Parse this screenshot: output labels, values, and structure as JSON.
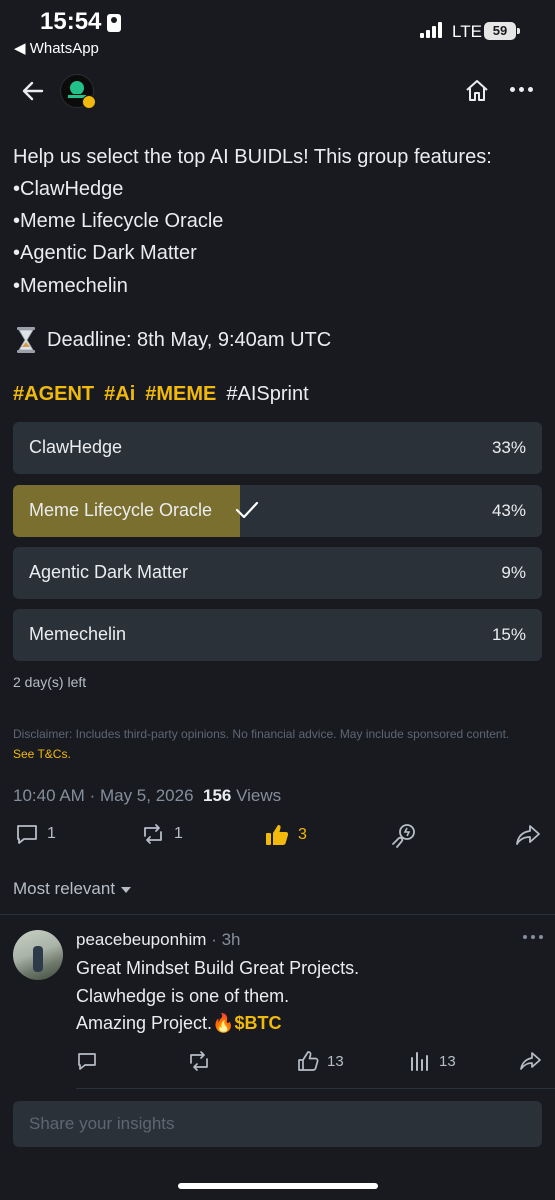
{
  "status_bar": {
    "time": "15:54",
    "back_app": "◀ WhatsApp",
    "network": "LTE",
    "battery": "59"
  },
  "post": {
    "lines": [
      "Help us select the top AI BUIDLs! This group features:",
      "•ClawHedge",
      "•Meme Lifecycle Oracle",
      "•Agentic Dark Matter",
      "•Memechelin"
    ],
    "deadline": "Deadline: 8th May, 9:40am UTC",
    "hashtags": [
      {
        "text": "#AGENT",
        "highlight": true
      },
      {
        "text": "#Ai",
        "highlight": true
      },
      {
        "text": "#MEME",
        "highlight": true
      },
      {
        "text": "#AISprint",
        "highlight": false
      }
    ]
  },
  "poll": {
    "options": [
      {
        "label": "ClawHedge",
        "percent": "33%",
        "fill_fraction": 0,
        "selected": false
      },
      {
        "label": "Meme Lifecycle Oracle",
        "percent": "43%",
        "fill_fraction": 0.43,
        "selected": true
      },
      {
        "label": "Agentic Dark Matter",
        "percent": "9%",
        "fill_fraction": 0,
        "selected": false
      },
      {
        "label": "Memechelin",
        "percent": "15%",
        "fill_fraction": 0,
        "selected": false
      }
    ],
    "remaining": "2 day(s) left",
    "fill_color": "#7a6f2e"
  },
  "disclaimer": {
    "text": "Disclaimer: Includes third-party opinions. No financial advice. May include sponsored content.",
    "link": "See T&Cs."
  },
  "meta": {
    "time": "10:40 AM",
    "separator": "·",
    "date": "May 5, 2026",
    "views_count": "156",
    "views_label": "Views"
  },
  "actions": {
    "comments": "1",
    "reposts": "1",
    "likes": "3"
  },
  "sort": {
    "selected": "Most relevant"
  },
  "comment": {
    "user": "peacebeuponhim",
    "dot": "·",
    "time": "3h",
    "lines": [
      "Great Mindset Build Great Projects.",
      "Clawhedge is one of them.",
      "Amazing Project.🔥"
    ],
    "coin": "$BTC",
    "likes": "13",
    "views": "13"
  },
  "input": {
    "placeholder": "Share your insights"
  },
  "colors": {
    "accent": "#f0b90b",
    "background": "#181a20",
    "panel": "#2b3139"
  },
  "icons": [
    "back-arrow-icon",
    "logo-avatar",
    "home-icon",
    "more-icon",
    "hourglass-icon",
    "check-icon",
    "comment-icon",
    "repost-icon",
    "thumbs-up-icon",
    "tip-icon",
    "share-icon",
    "bar-chart-icon"
  ]
}
